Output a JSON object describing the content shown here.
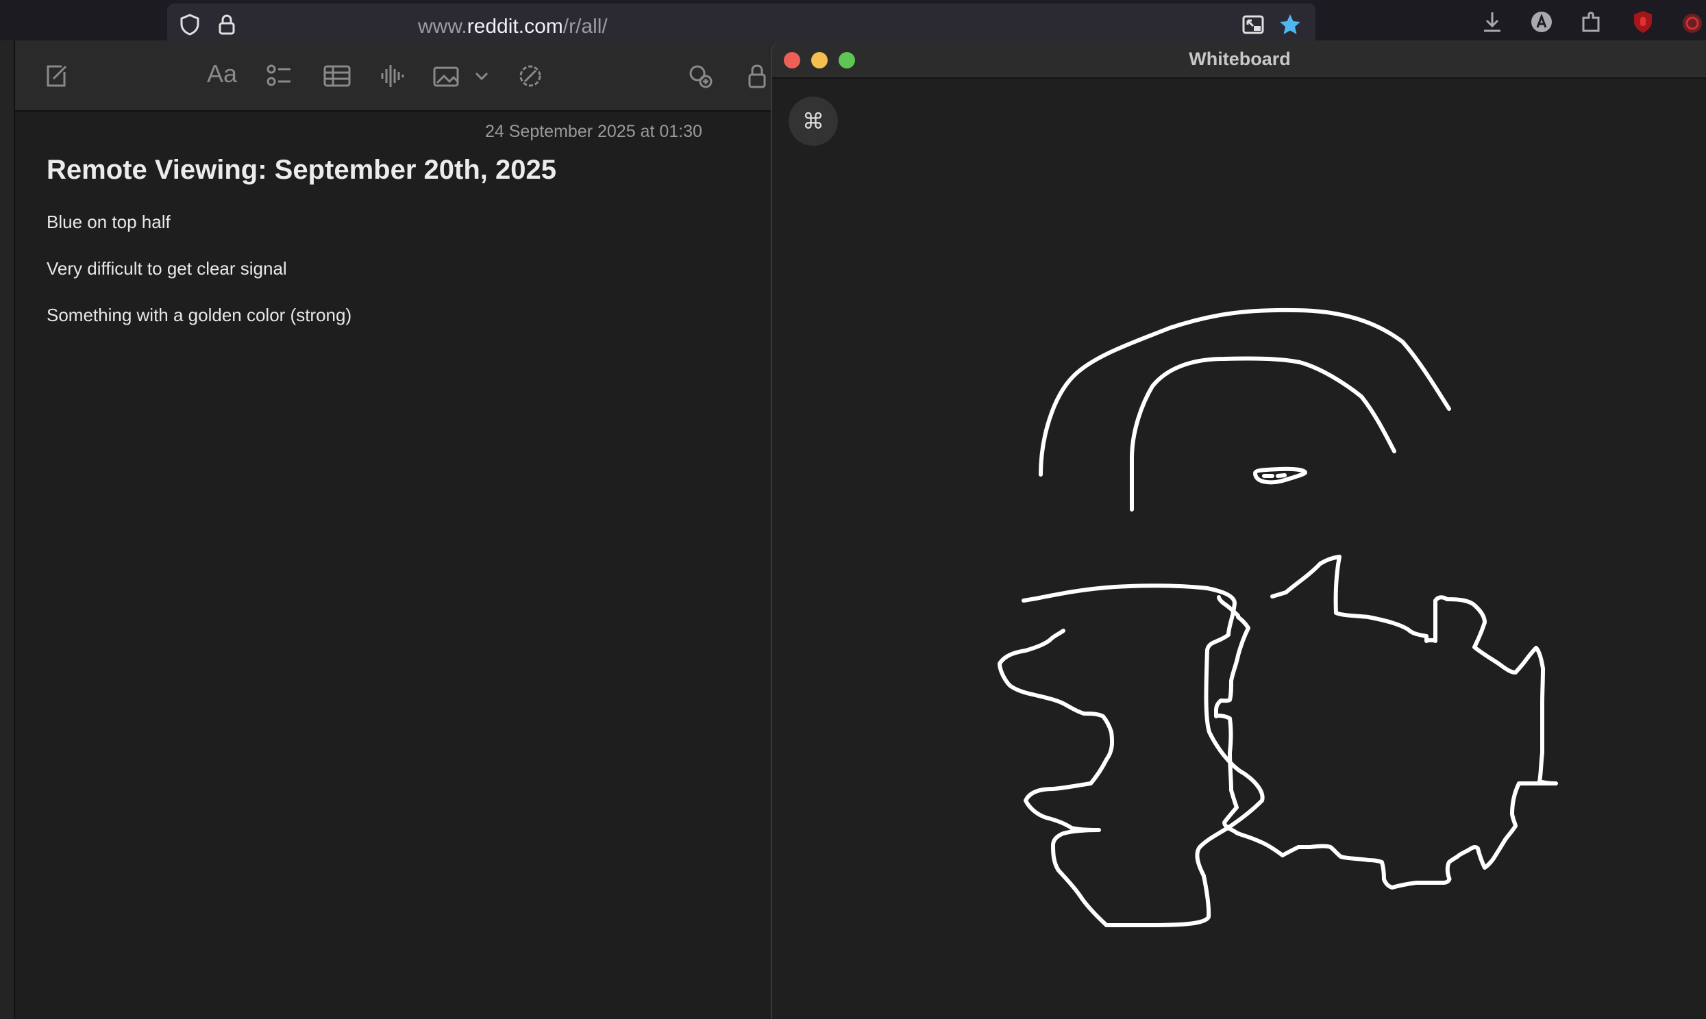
{
  "browser": {
    "url_prefix": "www.",
    "url_domain": "reddit.com",
    "url_path": "/r/all/"
  },
  "notes": {
    "toolbar": {
      "format_label": "Aa"
    },
    "date": "24 September 2025 at 01:30",
    "title": "Remote Viewing: September 20th, 2025",
    "lines": [
      "Blue on top half",
      "Very difficult to get clear signal",
      "Something with a golden color (strong)"
    ]
  },
  "whiteboard": {
    "title": "Whiteboard",
    "command_glyph": "⌘",
    "stroke_color": "#ffffff"
  },
  "colors": {
    "close": "#ed5f57",
    "minimize": "#f5be4f",
    "zoom": "#5fc554",
    "bookmark_star": "#4fb6f0"
  }
}
